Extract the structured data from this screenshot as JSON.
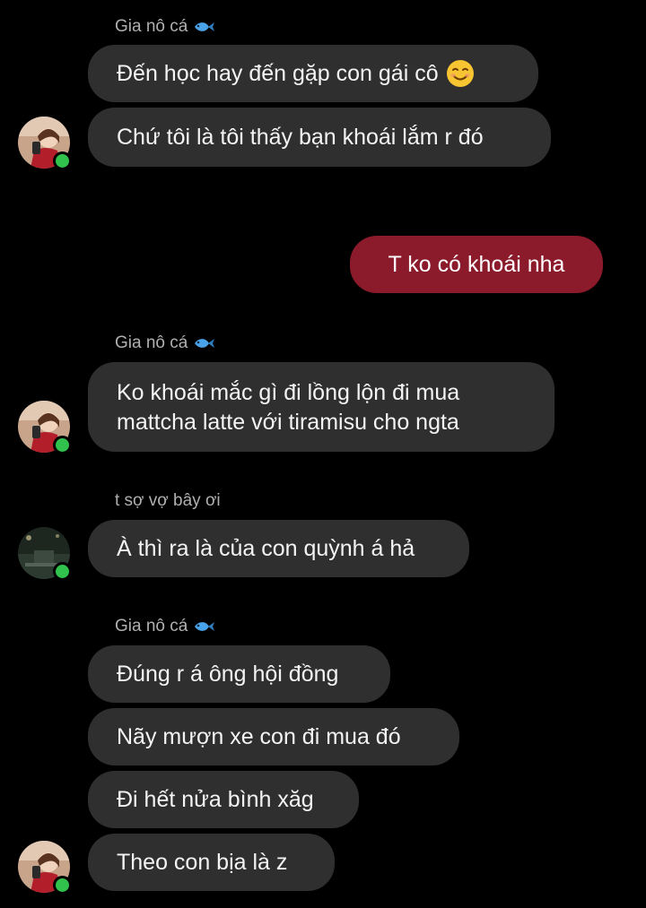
{
  "messages": [
    {
      "sender": "Gia nô cá",
      "text": "Đến học hay đến gặp con gái cô"
    },
    {
      "text": "Chứ tôi là tôi thấy bạn khoái lắm r đó"
    },
    {
      "text": "T ko có khoái nha",
      "mine": true
    },
    {
      "sender": "Gia nô cá",
      "line1": "Ko khoái mắc gì đi lồng lộn đi mua",
      "line2": "mattcha latte với tiramisu cho ngta"
    },
    {
      "sender": "t sợ vợ bây ơi",
      "text": "À thì ra là của con quỳnh á hả"
    },
    {
      "sender": "Gia nô cá",
      "text": "Đúng r á ông hội đồng"
    },
    {
      "text": "Nãy mượn xe con đi mua đó"
    },
    {
      "text": "Đi hết nửa bình xăg"
    },
    {
      "text": "Theo con bịa là z"
    }
  ],
  "icons": {
    "fish": "fish-icon",
    "smile": "smiling-face-emoji"
  },
  "colors": {
    "background": "#000000",
    "incoming": "#2f2f2f",
    "outgoing": "#8b1a2b",
    "online": "#31c24d"
  }
}
